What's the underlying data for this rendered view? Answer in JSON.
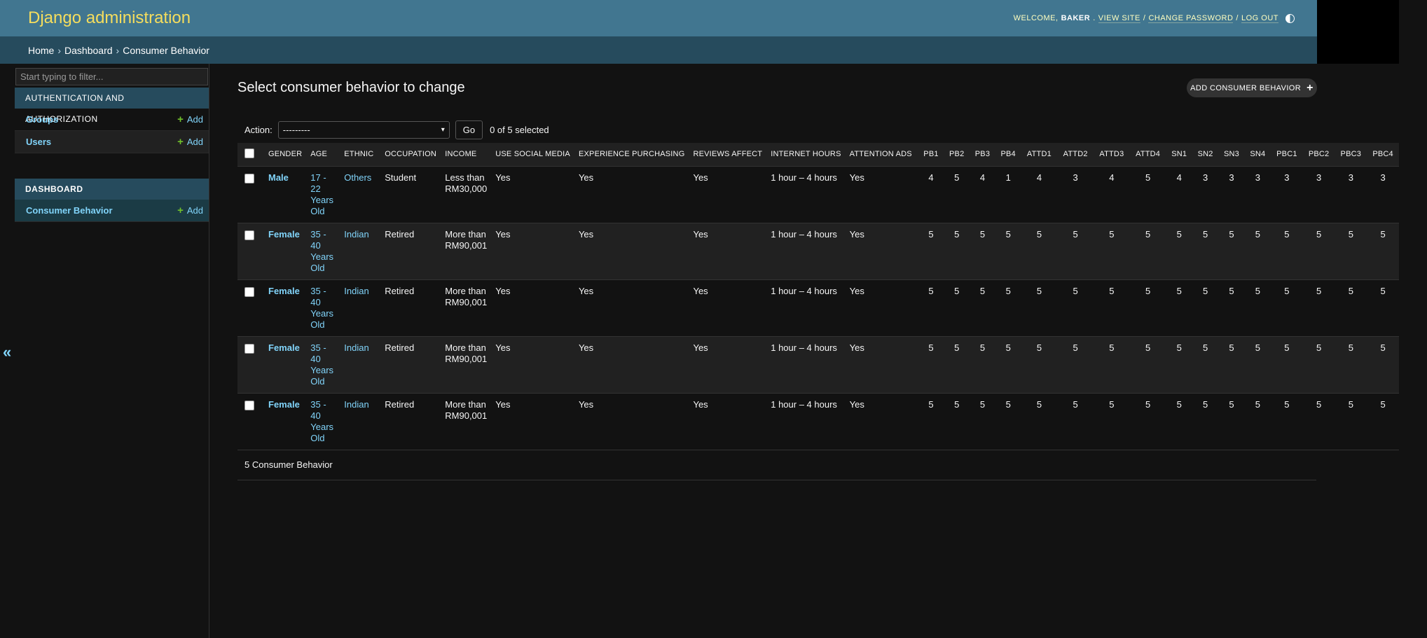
{
  "header": {
    "brand": "Django administration",
    "welcome": "Welcome,",
    "username": "Baker",
    "view_site": "View site",
    "change_password": "Change password",
    "log_out": "Log out",
    "sep": "/"
  },
  "breadcrumbs": {
    "home": "Home",
    "dashboard": "Dashboard",
    "current": "Consumer Behavior",
    "sep": "›"
  },
  "sidebar": {
    "filter_placeholder": "Start typing to filter...",
    "toggle": "«",
    "auth_module": {
      "caption": "Authentication and Authorization",
      "items": [
        {
          "label": "Groups",
          "add": "Add"
        },
        {
          "label": "Users",
          "add": "Add"
        }
      ]
    },
    "dashboard_module": {
      "caption": "Dashboard",
      "items": [
        {
          "label": "Consumer Behavior",
          "add": "Add"
        }
      ]
    }
  },
  "main": {
    "title": "Select consumer behavior to change",
    "add_button": "Add Consumer Behavior",
    "action_label": "Action:",
    "action_selected": "---------",
    "go": "Go",
    "selected_count": "0 of 5 selected",
    "columns": [
      "Gender",
      "Age",
      "Ethnic",
      "Occupation",
      "Income",
      "Use Social Media",
      "Experience Purchasing",
      "Reviews Affect",
      "Internet Hours",
      "Attention Ads",
      "PB1",
      "PB2",
      "PB3",
      "PB4",
      "ATTD1",
      "ATTD2",
      "ATTD3",
      "ATTD4",
      "SN1",
      "SN2",
      "SN3",
      "SN4",
      "PBC1",
      "PBC2",
      "PBC3",
      "PBC4"
    ],
    "rows": [
      {
        "gender": "Male",
        "age": "17 - 22 Years Old",
        "ethnic": "Others",
        "occupation": "Student",
        "income": "Less than RM30,000",
        "social": "Yes",
        "purchasing": "Yes",
        "reviews": "Yes",
        "hours": "1 hour – 4 hours",
        "ads": "Yes",
        "scores": [
          "4",
          "5",
          "4",
          "1",
          "4",
          "3",
          "4",
          "5",
          "4",
          "3",
          "3",
          "3",
          "3",
          "3",
          "3",
          "3"
        ]
      },
      {
        "gender": "Female",
        "age": "35 - 40 Years Old",
        "ethnic": "Indian",
        "occupation": "Retired",
        "income": "More than RM90,001",
        "social": "Yes",
        "purchasing": "Yes",
        "reviews": "Yes",
        "hours": "1 hour – 4 hours",
        "ads": "Yes",
        "scores": [
          "5",
          "5",
          "5",
          "5",
          "5",
          "5",
          "5",
          "5",
          "5",
          "5",
          "5",
          "5",
          "5",
          "5",
          "5",
          "5"
        ]
      },
      {
        "gender": "Female",
        "age": "35 - 40 Years Old",
        "ethnic": "Indian",
        "occupation": "Retired",
        "income": "More than RM90,001",
        "social": "Yes",
        "purchasing": "Yes",
        "reviews": "Yes",
        "hours": "1 hour – 4 hours",
        "ads": "Yes",
        "scores": [
          "5",
          "5",
          "5",
          "5",
          "5",
          "5",
          "5",
          "5",
          "5",
          "5",
          "5",
          "5",
          "5",
          "5",
          "5",
          "5"
        ]
      },
      {
        "gender": "Female",
        "age": "35 - 40 Years Old",
        "ethnic": "Indian",
        "occupation": "Retired",
        "income": "More than RM90,001",
        "social": "Yes",
        "purchasing": "Yes",
        "reviews": "Yes",
        "hours": "1 hour – 4 hours",
        "ads": "Yes",
        "scores": [
          "5",
          "5",
          "5",
          "5",
          "5",
          "5",
          "5",
          "5",
          "5",
          "5",
          "5",
          "5",
          "5",
          "5",
          "5",
          "5"
        ]
      },
      {
        "gender": "Female",
        "age": "35 - 40 Years Old",
        "ethnic": "Indian",
        "occupation": "Retired",
        "income": "More than RM90,001",
        "social": "Yes",
        "purchasing": "Yes",
        "reviews": "Yes",
        "hours": "1 hour – 4 hours",
        "ads": "Yes",
        "scores": [
          "5",
          "5",
          "5",
          "5",
          "5",
          "5",
          "5",
          "5",
          "5",
          "5",
          "5",
          "5",
          "5",
          "5",
          "5",
          "5"
        ]
      }
    ],
    "paginator": "5 Consumer Behavior"
  },
  "colors": {
    "header_bg": "#417690",
    "breadcrumb_bg": "#264b5d",
    "brand": "#f5dd5d",
    "link": "#81d4fa",
    "add_green": "#70bf2b"
  },
  "icons": [
    "theme-toggle-icon",
    "add-icon",
    "collapse-sidebar-icon",
    "dropdown-chevron-icon"
  ]
}
